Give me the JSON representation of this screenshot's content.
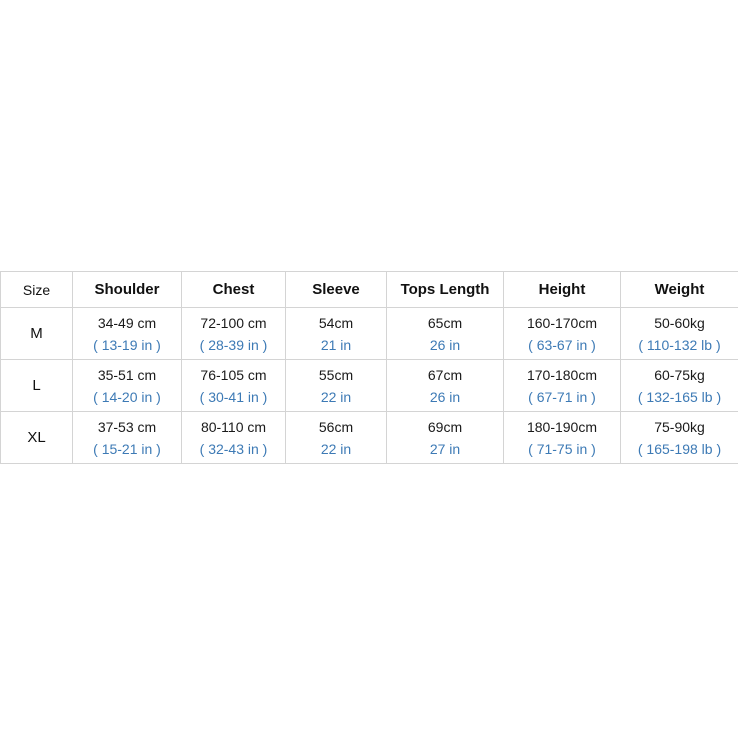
{
  "colors": {
    "imperial_text": "#3d7ab5",
    "border": "#d4d4d4",
    "text": "#111111"
  },
  "table": {
    "headers": [
      "Size",
      "Shoulder",
      "Chest",
      "Sleeve",
      "Tops Length",
      "Height",
      "Weight"
    ],
    "rows": [
      {
        "size": "M",
        "cells": [
          {
            "metric": "34-49 cm",
            "imperial": "( 13-19 in )"
          },
          {
            "metric": "72-100 cm",
            "imperial": "( 28-39 in )"
          },
          {
            "metric": "54cm",
            "imperial": "21 in"
          },
          {
            "metric": "65cm",
            "imperial": "26 in"
          },
          {
            "metric": "160-170cm",
            "imperial": "( 63-67 in )"
          },
          {
            "metric": "50-60kg",
            "imperial": "( 110-132 lb )"
          }
        ]
      },
      {
        "size": "L",
        "cells": [
          {
            "metric": "35-51 cm",
            "imperial": "( 14-20 in )"
          },
          {
            "metric": "76-105 cm",
            "imperial": "( 30-41 in )"
          },
          {
            "metric": "55cm",
            "imperial": "22 in"
          },
          {
            "metric": "67cm",
            "imperial": "26 in"
          },
          {
            "metric": "170-180cm",
            "imperial": "( 67-71 in )"
          },
          {
            "metric": "60-75kg",
            "imperial": "( 132-165 lb )"
          }
        ]
      },
      {
        "size": "XL",
        "cells": [
          {
            "metric": "37-53 cm",
            "imperial": "( 15-21 in )"
          },
          {
            "metric": "80-110 cm",
            "imperial": "( 32-43 in )"
          },
          {
            "metric": "56cm",
            "imperial": "22 in"
          },
          {
            "metric": "69cm",
            "imperial": "27 in"
          },
          {
            "metric": "180-190cm",
            "imperial": "( 71-75 in )"
          },
          {
            "metric": "75-90kg",
            "imperial": "( 165-198 lb )"
          }
        ]
      }
    ]
  }
}
